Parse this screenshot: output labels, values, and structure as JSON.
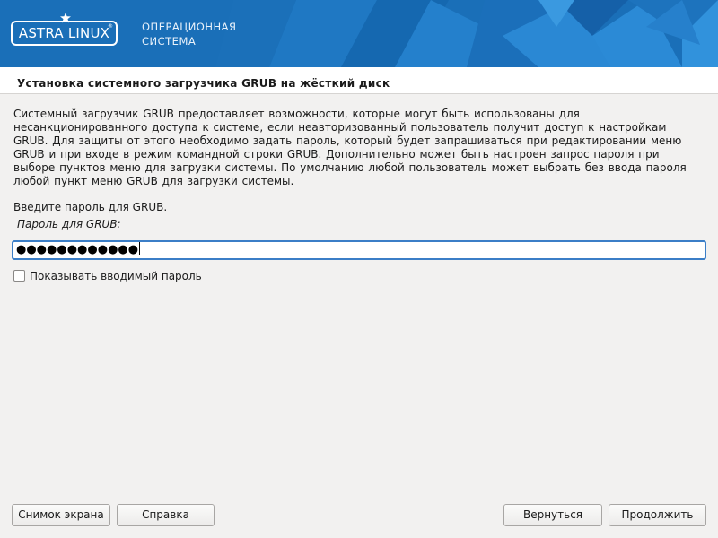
{
  "header": {
    "logo_text": "ASTRA LINUX",
    "logo_mark": "®",
    "tagline_line1": "ОПЕРАЦИОННАЯ",
    "tagline_line2": "СИСТЕМА",
    "brand_color": "#1a6fb8"
  },
  "page": {
    "title": "Установка системного загрузчика GRUB на жёсткий диск",
    "description": "Системный загрузчик GRUB предоставляет возможности, которые могут быть использованы для несанкционированного доступа к системе, если неавторизованный пользователь получит доступ к настройкам GRUB. Для защиты от этого необходимо задать пароль, который будет запрашиваться при редактировании меню GRUB и при входе в режим командной строки GRUB. Дополнительно может быть настроен запрос пароля при выборе пунктов меню для загрузки системы. По умолчанию любой пользователь может выбрать без ввода пароля любой пункт меню GRUB для загрузки системы.",
    "prompt": "Введите пароль для GRUB.",
    "field_label": "Пароль для GRUB:",
    "password_masked": "●●●●●●●●●●●●",
    "show_password_label": "Показывать вводимый пароль",
    "show_password_checked": false
  },
  "buttons": {
    "screenshot": "Снимок экрана",
    "help": "Справка",
    "back": "Вернуться",
    "continue": "Продолжить"
  },
  "icons": {
    "logo_star": "star-icon"
  }
}
